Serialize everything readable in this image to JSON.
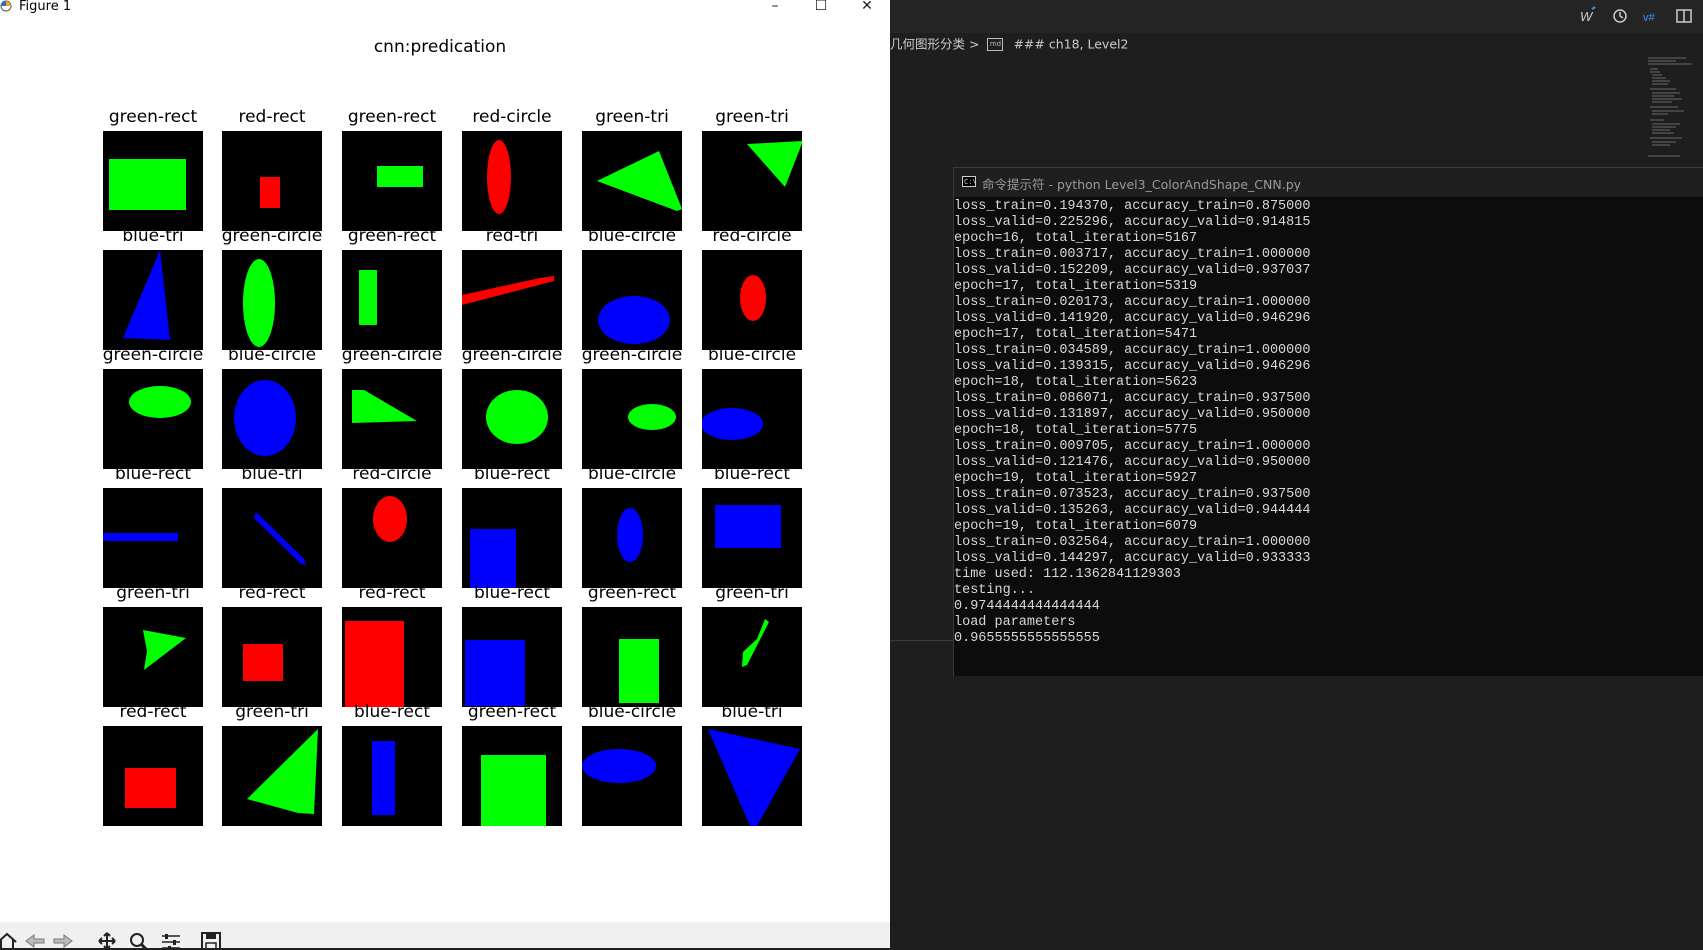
{
  "figure_window": {
    "title": "Figure 1",
    "controls": {
      "minimize": "–",
      "maximize": "☐",
      "close": "✕"
    },
    "suptitle": "cnn:predication",
    "predictions": [
      [
        {
          "label": "green-rect",
          "color": "green",
          "shape": "rect"
        },
        {
          "label": "red-rect",
          "color": "red",
          "shape": "rect"
        },
        {
          "label": "green-rect",
          "color": "green",
          "shape": "rect"
        },
        {
          "label": "red-circle",
          "color": "red",
          "shape": "circle"
        },
        {
          "label": "green-tri",
          "color": "green",
          "shape": "tri"
        },
        {
          "label": "green-tri",
          "color": "green",
          "shape": "tri"
        }
      ],
      [
        {
          "label": "blue-tri",
          "color": "blue",
          "shape": "tri"
        },
        {
          "label": "green-circle",
          "color": "green",
          "shape": "circle"
        },
        {
          "label": "green-rect",
          "color": "green",
          "shape": "rect"
        },
        {
          "label": "red-tri",
          "color": "red",
          "shape": "tri"
        },
        {
          "label": "blue-circle",
          "color": "blue",
          "shape": "circle"
        },
        {
          "label": "red-circle",
          "color": "red",
          "shape": "circle"
        }
      ],
      [
        {
          "label": "green-circle",
          "color": "green",
          "shape": "circle"
        },
        {
          "label": "blue-circle",
          "color": "blue",
          "shape": "circle"
        },
        {
          "label": "green-circle",
          "color": "green",
          "shape": "tri"
        },
        {
          "label": "green-circle",
          "color": "green",
          "shape": "circle"
        },
        {
          "label": "green-circle",
          "color": "green",
          "shape": "circle"
        },
        {
          "label": "blue-circle",
          "color": "blue",
          "shape": "circle"
        }
      ],
      [
        {
          "label": "blue-rect",
          "color": "blue",
          "shape": "rect"
        },
        {
          "label": "blue-tri",
          "color": "blue",
          "shape": "tri"
        },
        {
          "label": "red-circle",
          "color": "red",
          "shape": "circle"
        },
        {
          "label": "blue-rect",
          "color": "blue",
          "shape": "rect"
        },
        {
          "label": "blue-circle",
          "color": "blue",
          "shape": "circle"
        },
        {
          "label": "blue-rect",
          "color": "blue",
          "shape": "rect"
        }
      ],
      [
        {
          "label": "green-tri",
          "color": "green",
          "shape": "tri"
        },
        {
          "label": "red-rect",
          "color": "red",
          "shape": "rect"
        },
        {
          "label": "red-rect",
          "color": "red",
          "shape": "rect"
        },
        {
          "label": "blue-rect",
          "color": "blue",
          "shape": "rect"
        },
        {
          "label": "green-rect",
          "color": "green",
          "shape": "rect"
        },
        {
          "label": "green-tri",
          "color": "green",
          "shape": "tri"
        }
      ],
      [
        {
          "label": "red-rect",
          "color": "red",
          "shape": "rect"
        },
        {
          "label": "green-tri",
          "color": "green",
          "shape": "tri"
        },
        {
          "label": "blue-rect",
          "color": "blue",
          "shape": "rect"
        },
        {
          "label": "green-rect",
          "color": "green",
          "shape": "rect"
        },
        {
          "label": "blue-circle",
          "color": "blue",
          "shape": "circle"
        },
        {
          "label": "blue-tri",
          "color": "blue",
          "shape": "tri"
        }
      ]
    ],
    "toolbar_icons": [
      "home-icon",
      "back-icon",
      "forward-icon",
      "pan-icon",
      "zoom-icon",
      "configure-subplots-icon",
      "save-icon"
    ]
  },
  "editor": {
    "topbar_icons": [
      "word-icon",
      "history-icon",
      "vb-icon",
      "layout-icon"
    ],
    "breadcrumb": {
      "folder": "几何图形分类",
      "separator": ">",
      "cell": "### ch18, Level2"
    }
  },
  "cmd_window": {
    "title": "命令提示符 - python  Level3_ColorAndShape_CNN.py",
    "lines": [
      "loss_train=0.194370, accuracy_train=0.875000",
      "loss_valid=0.225296, accuracy_valid=0.914815",
      "epoch=16, total_iteration=5167",
      "loss_train=0.003717, accuracy_train=1.000000",
      "loss_valid=0.152209, accuracy_valid=0.937037",
      "epoch=17, total_iteration=5319",
      "loss_train=0.020173, accuracy_train=1.000000",
      "loss_valid=0.141920, accuracy_valid=0.946296",
      "epoch=17, total_iteration=5471",
      "loss_train=0.034589, accuracy_train=1.000000",
      "loss_valid=0.139315, accuracy_valid=0.946296",
      "epoch=18, total_iteration=5623",
      "loss_train=0.086071, accuracy_train=0.937500",
      "loss_valid=0.131897, accuracy_valid=0.950000",
      "epoch=18, total_iteration=5775",
      "loss_train=0.009705, accuracy_train=1.000000",
      "loss_valid=0.121476, accuracy_valid=0.950000",
      "epoch=19, total_iteration=5927",
      "loss_train=0.073523, accuracy_train=0.937500",
      "loss_valid=0.135263, accuracy_valid=0.944444",
      "epoch=19, total_iteration=6079",
      "loss_train=0.032564, accuracy_train=1.000000",
      "loss_valid=0.144297, accuracy_valid=0.933333",
      "time used: 112.1362841129303",
      "testing...",
      "0.9744444444444444",
      "load parameters",
      "0.9655555555555555"
    ]
  },
  "colors": {
    "red": "#ff0000",
    "green": "#00ff00",
    "blue": "#0000ff"
  }
}
